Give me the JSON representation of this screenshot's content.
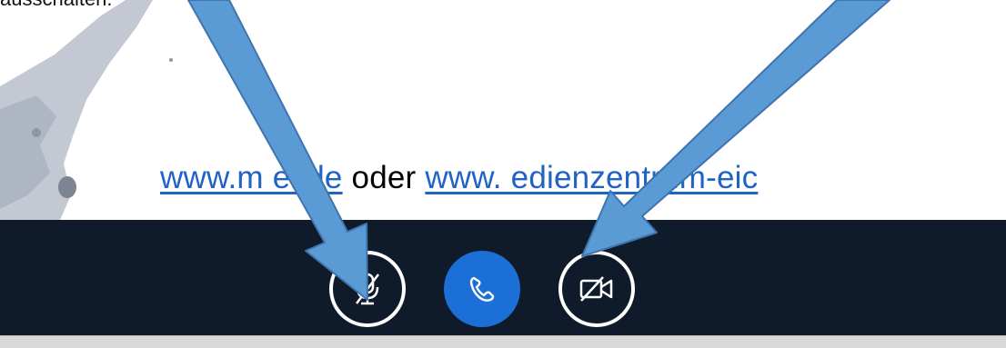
{
  "caption": {
    "text": "ausschalten."
  },
  "slide": {
    "link1": "www.m  ei.de",
    "middle": " oder ",
    "link2": "www.  edienzentrum-eic"
  },
  "controls": {
    "mute_icon": "microphone-muted-icon",
    "call_icon": "phone-icon",
    "camera_icon": "camera-off-icon"
  },
  "colors": {
    "bar": "#0f1a2b",
    "call_button": "#1c6fd6",
    "arrow_fill": "#5b9bd5",
    "arrow_stroke": "#3f74ad",
    "link": "#1f63c6"
  }
}
